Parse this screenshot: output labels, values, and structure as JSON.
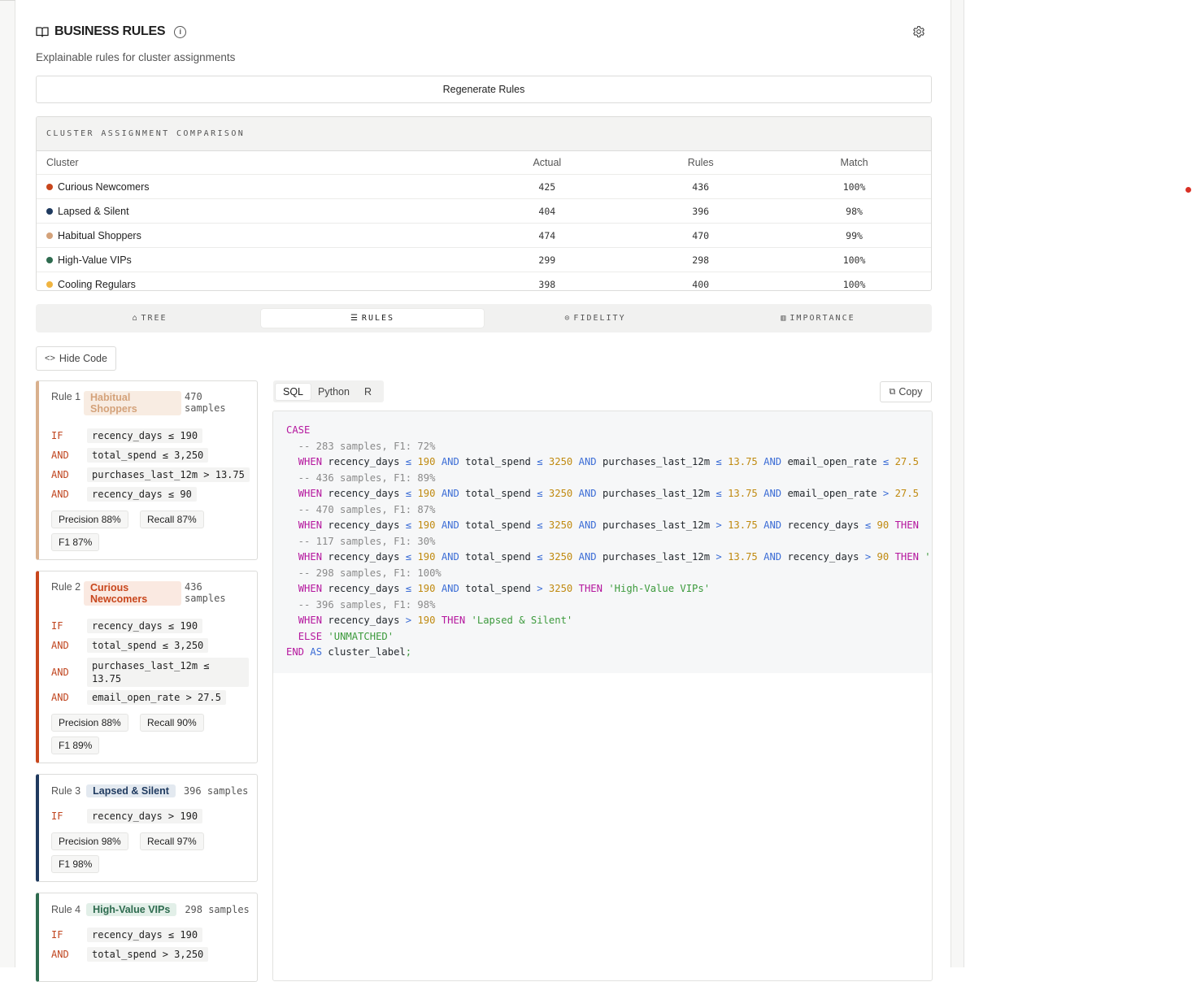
{
  "header": {
    "title": "BUSINESS RULES",
    "subtitle": "Explainable rules for cluster assignments"
  },
  "regenerate_label": "Regenerate Rules",
  "comparison": {
    "title": "CLUSTER ASSIGNMENT COMPARISON",
    "columns": [
      "Cluster",
      "Actual",
      "Rules",
      "Match"
    ],
    "rows": [
      {
        "name": "Curious Newcomers",
        "color": "#c8461c",
        "actual": "425",
        "rules": "436",
        "match": "100%"
      },
      {
        "name": "Lapsed & Silent",
        "color": "#1f3a5f",
        "actual": "404",
        "rules": "396",
        "match": "98%"
      },
      {
        "name": "Habitual Shoppers",
        "color": "#d4a27a",
        "actual": "474",
        "rules": "470",
        "match": "99%"
      },
      {
        "name": "High-Value VIPs",
        "color": "#2e6b4f",
        "actual": "299",
        "rules": "298",
        "match": "100%"
      },
      {
        "name": "Cooling Regulars",
        "color": "#f0b440",
        "actual": "398",
        "rules": "400",
        "match": "100%"
      }
    ]
  },
  "tabs": [
    "TREE",
    "RULES",
    "FIDELITY",
    "IMPORTANCE"
  ],
  "hide_code_label": "Hide Code",
  "rules": [
    {
      "label": "Rule 1",
      "cluster": "Habitual Shoppers",
      "samples": "470 samples",
      "conds": [
        {
          "kw": "IF",
          "expr": "recency_days ≤ 190"
        },
        {
          "kw": "AND",
          "expr": "total_spend ≤ 3,250"
        },
        {
          "kw": "AND",
          "expr": "purchases_last_12m > 13.75"
        },
        {
          "kw": "AND",
          "expr": "recency_days ≤ 90"
        }
      ],
      "precision": "Precision 88%",
      "recall": "Recall 87%",
      "f1": "F1 87%"
    },
    {
      "label": "Rule 2",
      "cluster": "Curious Newcomers",
      "samples": "436 samples",
      "conds": [
        {
          "kw": "IF",
          "expr": "recency_days ≤ 190"
        },
        {
          "kw": "AND",
          "expr": "total_spend ≤ 3,250"
        },
        {
          "kw": "AND",
          "expr": "purchases_last_12m ≤ 13.75"
        },
        {
          "kw": "AND",
          "expr": "email_open_rate > 27.5"
        }
      ],
      "precision": "Precision 88%",
      "recall": "Recall 90%",
      "f1": "F1 89%"
    },
    {
      "label": "Rule 3",
      "cluster": "Lapsed & Silent",
      "samples": "396 samples",
      "conds": [
        {
          "kw": "IF",
          "expr": "recency_days > 190"
        }
      ],
      "precision": "Precision 98%",
      "recall": "Recall 97%",
      "f1": "F1 98%"
    },
    {
      "label": "Rule 4",
      "cluster": "High-Value VIPs",
      "samples": "298 samples",
      "conds": [
        {
          "kw": "IF",
          "expr": "recency_days ≤ 190"
        },
        {
          "kw": "AND",
          "expr": "total_spend > 3,250"
        }
      ]
    }
  ],
  "code": {
    "languages": [
      "SQL",
      "Python",
      "R"
    ],
    "active_language": "SQL",
    "copy_label": "Copy",
    "lines": [
      "CASE",
      "  -- 283 samples, F1: 72%",
      "  WHEN recency_days ≤ 190 AND total_spend ≤ 3250 AND purchases_last_12m ≤ 13.75 AND email_open_rate ≤ 27.5",
      "  -- 436 samples, F1: 89%",
      "  WHEN recency_days ≤ 190 AND total_spend ≤ 3250 AND purchases_last_12m ≤ 13.75 AND email_open_rate > 27.5",
      "  -- 470 samples, F1: 87%",
      "  WHEN recency_days ≤ 190 AND total_spend ≤ 3250 AND purchases_last_12m > 13.75 AND recency_days ≤ 90 THEN",
      "  -- 117 samples, F1: 30%",
      "  WHEN recency_days ≤ 190 AND total_spend ≤ 3250 AND purchases_last_12m > 13.75 AND recency_days > 90 THEN '",
      "  -- 298 samples, F1: 100%",
      "  WHEN recency_days ≤ 190 AND total_spend > 3250 THEN 'High-Value VIPs'",
      "  -- 396 samples, F1: 98%",
      "  WHEN recency_days > 190 THEN 'Lapsed & Silent'",
      "  ELSE 'UNMATCHED'",
      "END AS cluster_label;"
    ]
  }
}
